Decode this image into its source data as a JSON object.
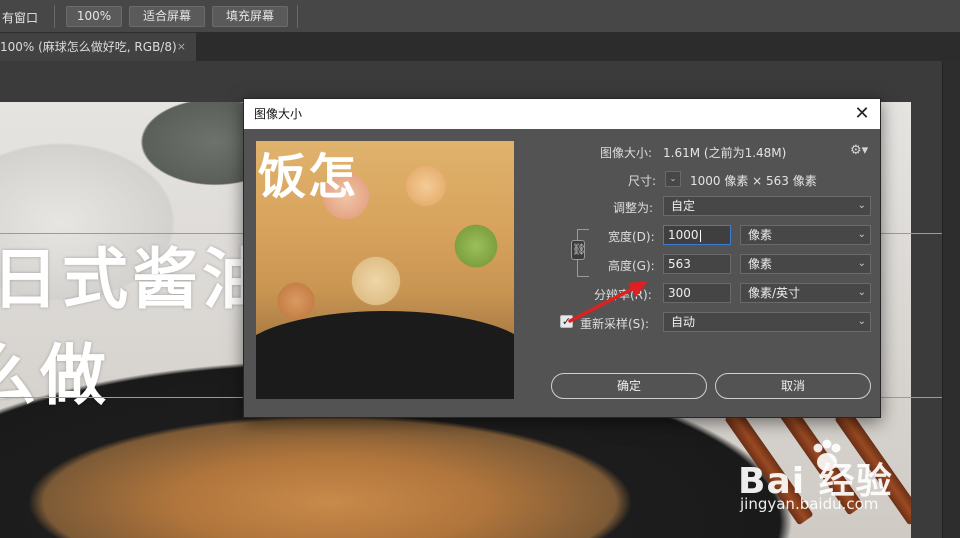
{
  "optbar": {
    "left_text": "有窗口",
    "buttons": [
      "100%",
      "适合屏幕",
      "填充屏幕"
    ]
  },
  "tab": {
    "title": "100% (麻球怎么做好吃, RGB/8)",
    "close": "×"
  },
  "canvas": {
    "line1": "日式酱油",
    "line2": "么做",
    "watermark_logo": "Bai  经验",
    "watermark_url": "jingyan.baidu.com"
  },
  "dialog": {
    "title": "图像大小",
    "close": "✕",
    "preview_text": "饭怎",
    "image_size_label": "图像大小:",
    "image_size_value": "1.61M (之前为1.48M)",
    "dimensions_label": "尺寸:",
    "dimensions_unit_chevron": "⌄",
    "dimensions_value": "1000 像素 × 563 像素",
    "fit_label": "调整为:",
    "fit_value": "自定",
    "width_label": "宽度(D):",
    "width_value": "1000",
    "width_unit": "像素",
    "height_label": "高度(G):",
    "height_value": "563",
    "height_unit": "像素",
    "resolution_label": "分辨率(R):",
    "resolution_value": "300",
    "resolution_unit": "像素/英寸",
    "resample_label": "重新采样(S):",
    "resample_checked": true,
    "resample_value": "自动",
    "ok": "确定",
    "cancel": "取消"
  },
  "icons": {
    "gear": "gear-icon",
    "link": "chain-link-icon",
    "chevron": "chevron-down-icon",
    "annotation_arrow": "red-arrow"
  },
  "colors": {
    "guide": "#3fbfd6",
    "arrow": "#e02020",
    "focus": "#3d7bd0"
  }
}
